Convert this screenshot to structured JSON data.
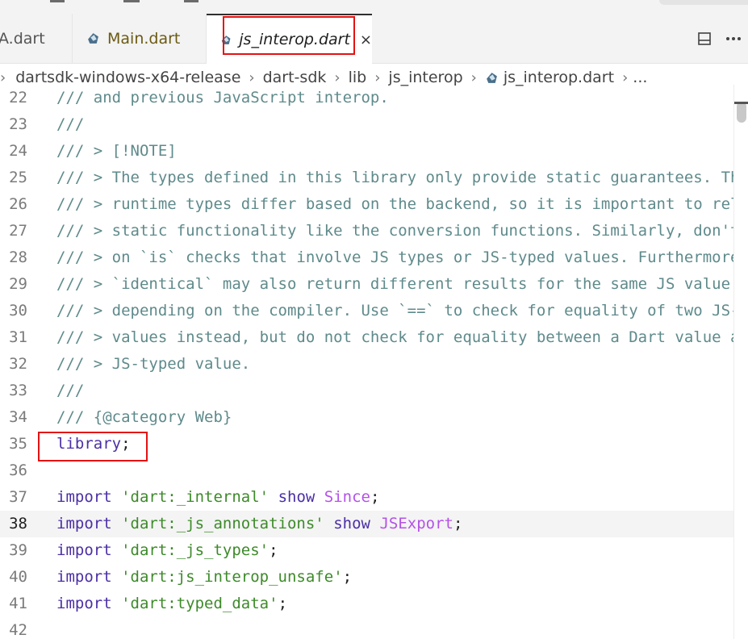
{
  "tabs": [
    {
      "label": "A.dart"
    },
    {
      "label": "Main.dart"
    },
    {
      "label": "js_interop.dart",
      "close": "×"
    }
  ],
  "actions": {
    "split_icon": "split-editor-icon",
    "more_icon": "more-actions-icon"
  },
  "breadcrumb": [
    "dartsdk-windows-x64-release",
    "dart-sdk",
    "lib",
    "js_interop",
    "js_interop.dart",
    "..."
  ],
  "lines": [
    {
      "n": "22",
      "tokens": [
        [
          "comment",
          "/// and previous JavaScript interop."
        ]
      ]
    },
    {
      "n": "23",
      "tokens": [
        [
          "comment",
          "///"
        ]
      ]
    },
    {
      "n": "24",
      "tokens": [
        [
          "comment",
          "/// > [!NOTE]"
        ]
      ]
    },
    {
      "n": "25",
      "tokens": [
        [
          "comment",
          "/// > The types defined in this library only provide static guarantees. Th"
        ]
      ]
    },
    {
      "n": "26",
      "tokens": [
        [
          "comment",
          "/// > runtime types differ based on the backend, so it is important to rel"
        ]
      ]
    },
    {
      "n": "27",
      "tokens": [
        [
          "comment",
          "/// > static functionality like the conversion functions. Similarly, don't"
        ]
      ]
    },
    {
      "n": "28",
      "tokens": [
        [
          "comment",
          "/// > on `is` checks that involve JS types or JS-typed values. Furthermore"
        ]
      ]
    },
    {
      "n": "29",
      "tokens": [
        [
          "comment",
          "/// > `identical` may also return different results for the same JS value"
        ]
      ]
    },
    {
      "n": "30",
      "tokens": [
        [
          "comment",
          "/// > depending on the compiler. Use `==` to check for equality of two JS-"
        ]
      ]
    },
    {
      "n": "31",
      "tokens": [
        [
          "comment",
          "/// > values instead, but do not check for equality between a Dart value a"
        ]
      ]
    },
    {
      "n": "32",
      "tokens": [
        [
          "comment",
          "/// > JS-typed value."
        ]
      ]
    },
    {
      "n": "33",
      "tokens": [
        [
          "comment",
          "///"
        ]
      ]
    },
    {
      "n": "34",
      "tokens": [
        [
          "comment",
          "/// {@category Web}"
        ]
      ]
    },
    {
      "n": "35",
      "tokens": [
        [
          "kw",
          "library"
        ],
        [
          "plain",
          ";"
        ]
      ]
    },
    {
      "n": "36",
      "tokens": []
    },
    {
      "n": "37",
      "tokens": [
        [
          "kw",
          "import"
        ],
        [
          "plain",
          " "
        ],
        [
          "str",
          "'dart:_internal'"
        ],
        [
          "plain",
          " "
        ],
        [
          "kw",
          "show"
        ],
        [
          "plain",
          " "
        ],
        [
          "type",
          "Since"
        ],
        [
          "plain",
          ";"
        ]
      ]
    },
    {
      "n": "38",
      "current": true,
      "tokens": [
        [
          "kw",
          "import"
        ],
        [
          "plain",
          " "
        ],
        [
          "str",
          "'dart:_js_annotations'"
        ],
        [
          "plain",
          " "
        ],
        [
          "kw",
          "show"
        ],
        [
          "plain",
          " "
        ],
        [
          "type",
          "JSExport"
        ],
        [
          "plain",
          ";"
        ]
      ]
    },
    {
      "n": "39",
      "tokens": [
        [
          "kw",
          "import"
        ],
        [
          "plain",
          " "
        ],
        [
          "str",
          "'dart:_js_types'"
        ],
        [
          "plain",
          ";"
        ]
      ]
    },
    {
      "n": "40",
      "tokens": [
        [
          "kw",
          "import"
        ],
        [
          "plain",
          " "
        ],
        [
          "str",
          "'dart:js_interop_unsafe'"
        ],
        [
          "plain",
          ";"
        ]
      ]
    },
    {
      "n": "41",
      "tokens": [
        [
          "kw",
          "import"
        ],
        [
          "plain",
          " "
        ],
        [
          "str",
          "'dart:typed_data'"
        ],
        [
          "plain",
          ";"
        ]
      ]
    },
    {
      "n": "42",
      "tokens": []
    }
  ],
  "colors": {
    "comment": "#5f8a8b",
    "keyword": "#4b2fa5",
    "string": "#3d8a2a",
    "type": "#b452e8",
    "highlight": "#e41212"
  }
}
